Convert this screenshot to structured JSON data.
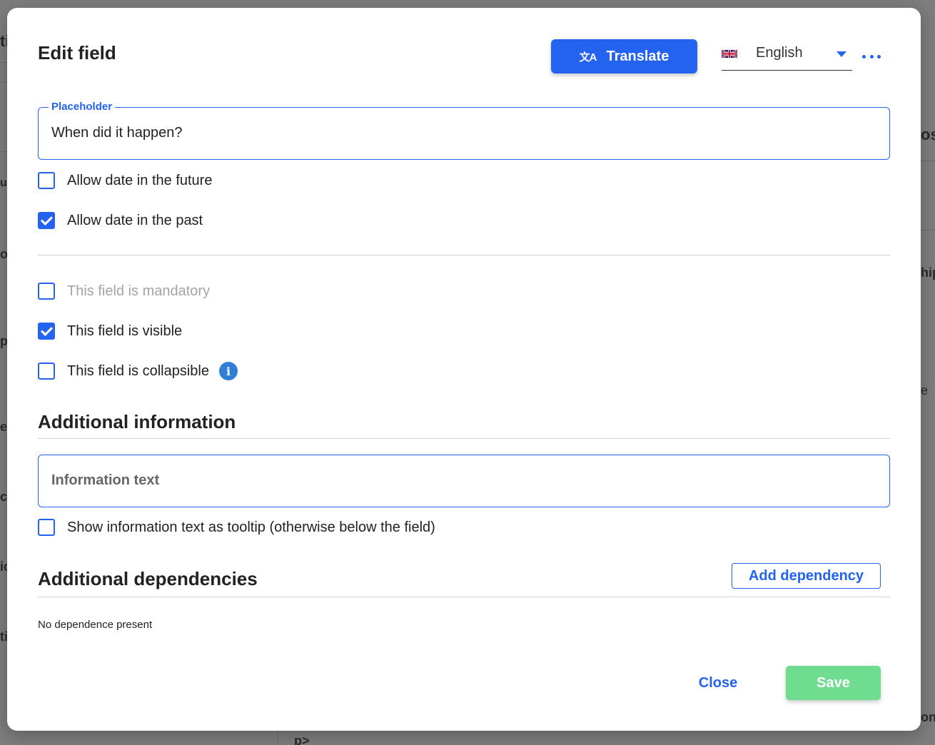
{
  "dialog": {
    "title": "Edit field",
    "translate_label": "Translate",
    "translate_icon": "translate-icon",
    "language": "English",
    "more_icon": "ellipsis-icon"
  },
  "placeholder_field": {
    "legend": "Placeholder",
    "value": "When did it happen?"
  },
  "date_options": [
    {
      "label": "Allow date in the future",
      "checked": false
    },
    {
      "label": "Allow date in the past",
      "checked": true
    }
  ],
  "field_options": [
    {
      "label": "This field is mandatory",
      "checked": false,
      "disabled": true
    },
    {
      "label": "This field is visible",
      "checked": true
    },
    {
      "label": "This field is collapsible",
      "checked": false
    }
  ],
  "additional_info": {
    "title": "Additional information",
    "input_placeholder": "Information text",
    "tooltip_option": "Show information text as tooltip (otherwise below the field)"
  },
  "dependencies": {
    "title": "Additional dependencies",
    "add_label": "Add dependency",
    "empty_text": "No dependence present"
  },
  "footer": {
    "close_label": "Close",
    "save_label": "Save"
  },
  "colors": {
    "accent": "#2463f0",
    "save": "#6fdc8f",
    "info": "#2f7fd6"
  },
  "background_fragments": [
    "ti",
    "os",
    "ut",
    "hip",
    "o",
    "p",
    "e",
    "e",
    "c",
    "ic",
    "ti",
    "on",
    "p>"
  ]
}
